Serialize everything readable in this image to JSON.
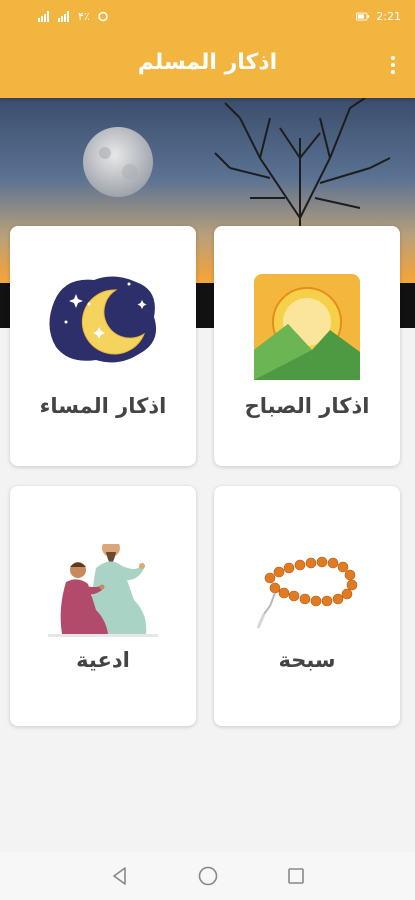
{
  "status_bar": {
    "left_indicators": "۴٪",
    "time": "2:21"
  },
  "app_bar": {
    "title": "اذكار المسلم",
    "overflow_icon": "more-vert-icon"
  },
  "header": {
    "image": "moon-sunset-tree-scene"
  },
  "cards": [
    {
      "label": "اذكار الصباح",
      "icon": "sunrise-mountains-icon"
    },
    {
      "label": "اذكار المساء",
      "icon": "crescent-moon-stars-icon"
    },
    {
      "label": "سبحة",
      "icon": "prayer-beads-icon"
    },
    {
      "label": "ادعية",
      "icon": "praying-people-icon"
    }
  ],
  "navigation": {
    "back_icon": "back-triangle-icon",
    "home_icon": "home-circle-icon",
    "recents_icon": "recents-square-icon"
  },
  "colors": {
    "accent": "#f2b540",
    "card_text": "#444444",
    "background": "#f3f3f3"
  }
}
